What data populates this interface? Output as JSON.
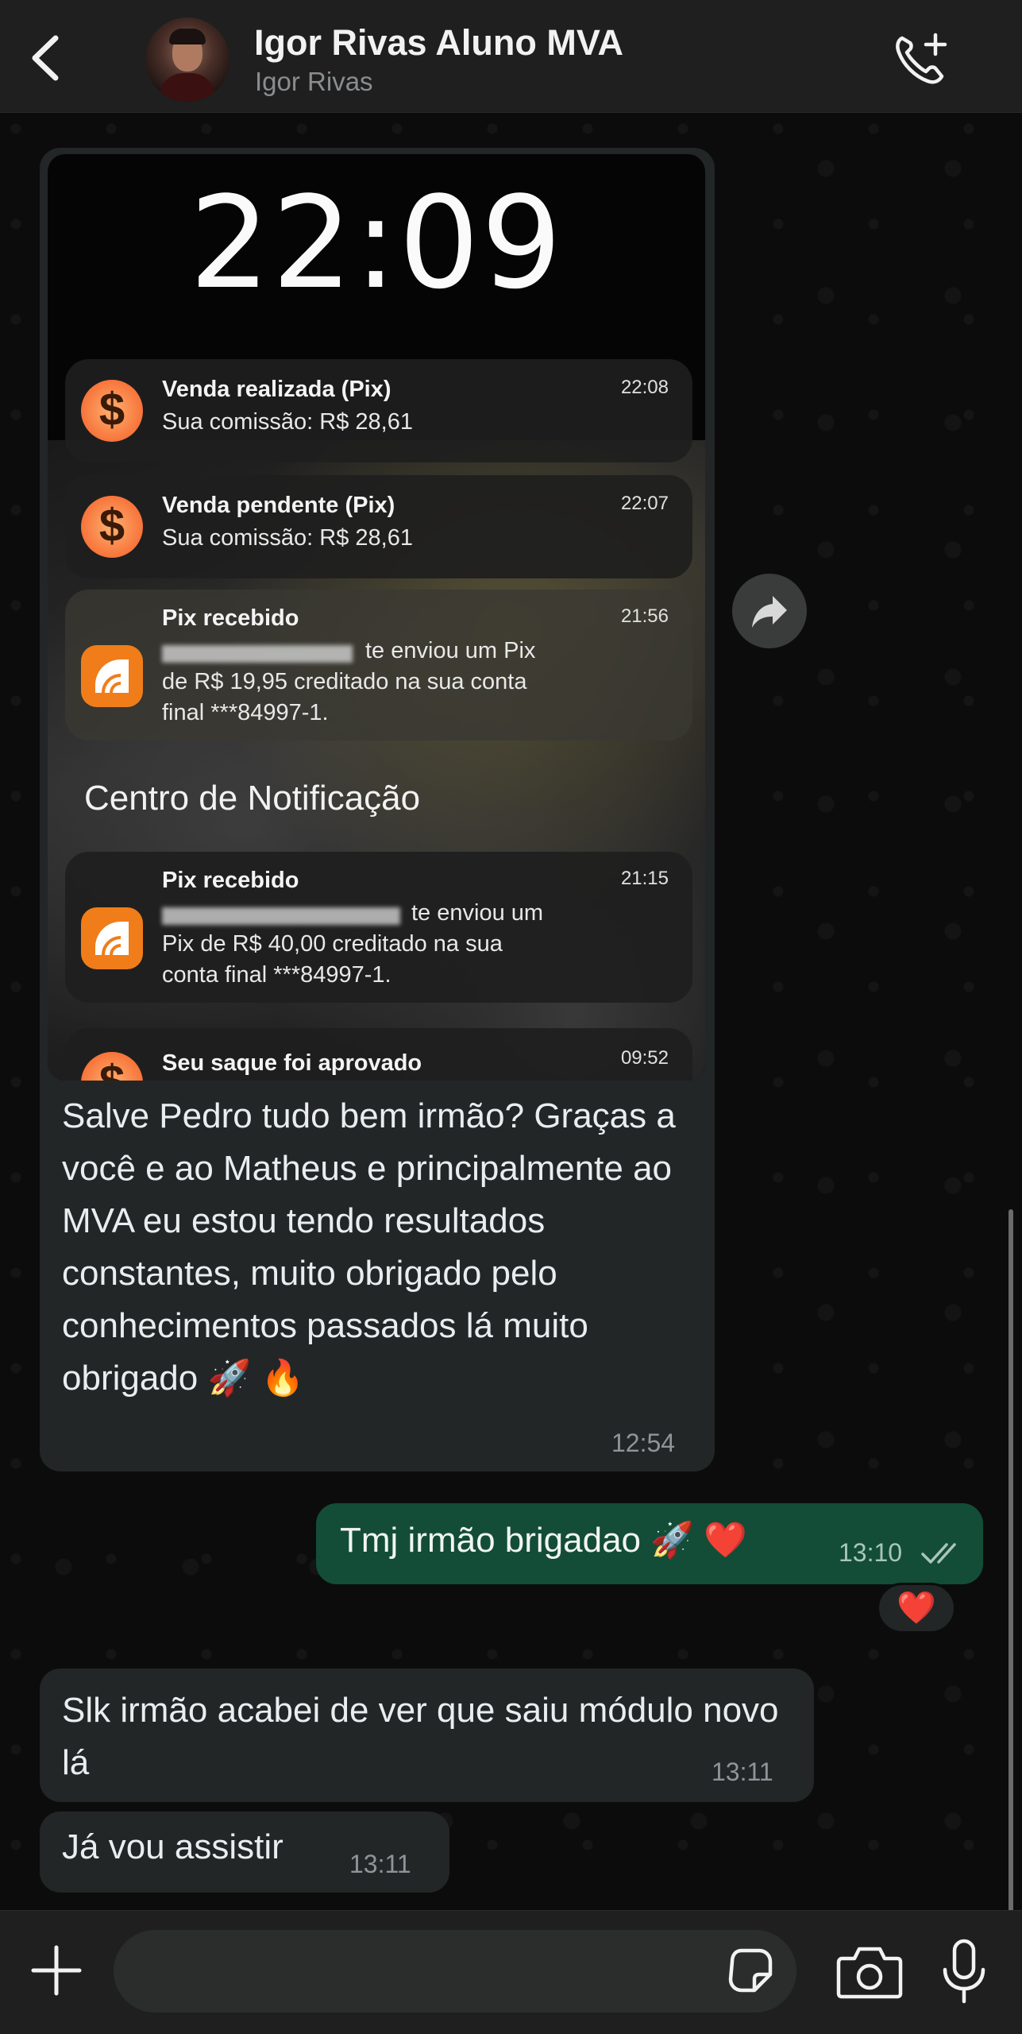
{
  "header": {
    "name": "Igor Rivas Aluno MVA",
    "subtitle": "Igor Rivas"
  },
  "screenshot": {
    "clock": "22:09",
    "notifications": [
      {
        "title": "Venda realizada (Pix)",
        "body": "Sua comissão: R$ 28,61",
        "time": "22:08",
        "icon": "coin-icon"
      },
      {
        "title": "Venda pendente (Pix)",
        "body": "Sua comissão: R$ 28,61",
        "time": "22:07",
        "icon": "coin-icon"
      },
      {
        "title": "Pix recebido",
        "body_line1": "te enviou um Pix",
        "body_line2": "de R$ 19,95 creditado na sua conta",
        "body_line3": "final ***84997-1.",
        "time": "21:56",
        "icon": "bank-icon"
      },
      {
        "title": "Pix recebido",
        "body_line1": "te enviou um",
        "body_line2": "Pix de R$ 40,00 creditado na sua",
        "body_line3": "conta final ***84997-1.",
        "time": "21:15",
        "icon": "bank-icon"
      },
      {
        "title": "Seu saque foi aprovado",
        "time": "09:52",
        "icon": "coin-icon"
      }
    ],
    "section_label": "Centro de Notificação"
  },
  "messages": [
    {
      "direction": "in",
      "text": "Salve Pedro tudo bem irmão? Graças a você e ao Matheus e principalmente ao MVA eu estou tendo resultados constantes, muito obrigado pelo conhecimentos passados lá muito obrigado 🚀 🔥",
      "time": "12:54"
    },
    {
      "direction": "out",
      "text": "Tmj irmão brigadao 🚀 ❤️",
      "time": "13:10",
      "reaction": "❤️"
    },
    {
      "direction": "in",
      "text": "Slk irmão acabei de ver que saiu módulo novo lá",
      "time": "13:11"
    },
    {
      "direction": "in",
      "text": "Já vou assistir",
      "time": "13:11"
    }
  ],
  "input": {
    "placeholder": ""
  },
  "colors": {
    "outgoing_bubble": "#134d37",
    "incoming_bubble": "#232626",
    "header": "#1f1f1f"
  }
}
